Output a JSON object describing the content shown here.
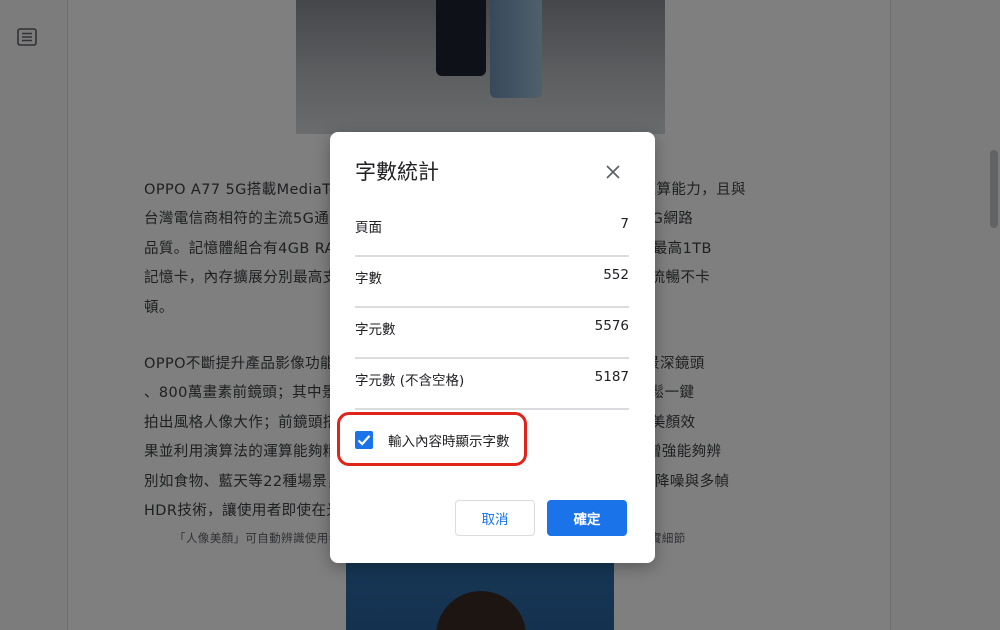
{
  "document": {
    "paragraph1": [
      "OPPO A77 5G搭載MediaTek Dimensity 810處理器，提供順暢遊戲時的運算能力，且與",
      "台灣電信商相符的主流5G通訊頻段支援，可享有通訊連線覆蓋範圍更全面的5G網路",
      "品質。記憶體組合有4GB RAM與64GB ROM儲存空間，且此版本並可再外接最高1TB",
      "記憶卡，內存擴展分別最高支援，不論是日常應用或是影音視聽娛樂時，都能流暢不卡",
      "頓。"
    ],
    "paragraph2": [
      "OPPO不斷提升產品影像功能，OPPO A77 5G相機配置為後置1,200萬畫素景深鏡頭",
      "、800萬畫素前鏡頭；其中景深鏡頭能夠實現背景虛化效果，套用內建濾鏡輕鬆一鍵",
      "拍出風格人像大作；前鏡頭搭載AI美顏功能，可自動辨識人像，提供最佳化的美顏效",
      "果並利用演算法的運算能夠精準判斷拍攝場景與主體，搭配A77 5G的AI場景增強能夠辨",
      "別如食物、藍天等22種場景，並針對夜間環境自動開啟夜景模式搭配複合多幀降噪與多幀",
      "HDR技術，讓使用者即使在光線不足的環境下也能拍出清晰照片。"
    ],
    "caption": "「人像美顏」可自動辨識使用者臉部輪廓並提供自然美顏效果，在背光時也能夠還原更多真實細節"
  },
  "dialog": {
    "title": "字數統計",
    "stats": [
      {
        "label": "頁面",
        "value": "7"
      },
      {
        "label": "字數",
        "value": "552"
      },
      {
        "label": "字元數",
        "value": "5576"
      },
      {
        "label": "字元數 (不含空格)",
        "value": "5187"
      }
    ],
    "checkbox_label": "輸入內容時顯示字數",
    "checkbox_checked": true,
    "cancel_label": "取消",
    "ok_label": "確定"
  },
  "colors": {
    "accent": "#1a73e8",
    "highlight_ring": "#e2231a",
    "overlay": "rgba(0,0,0,0.5)"
  },
  "icons": {
    "outline": "document-outline-icon",
    "close": "close-icon",
    "check": "check-icon"
  }
}
